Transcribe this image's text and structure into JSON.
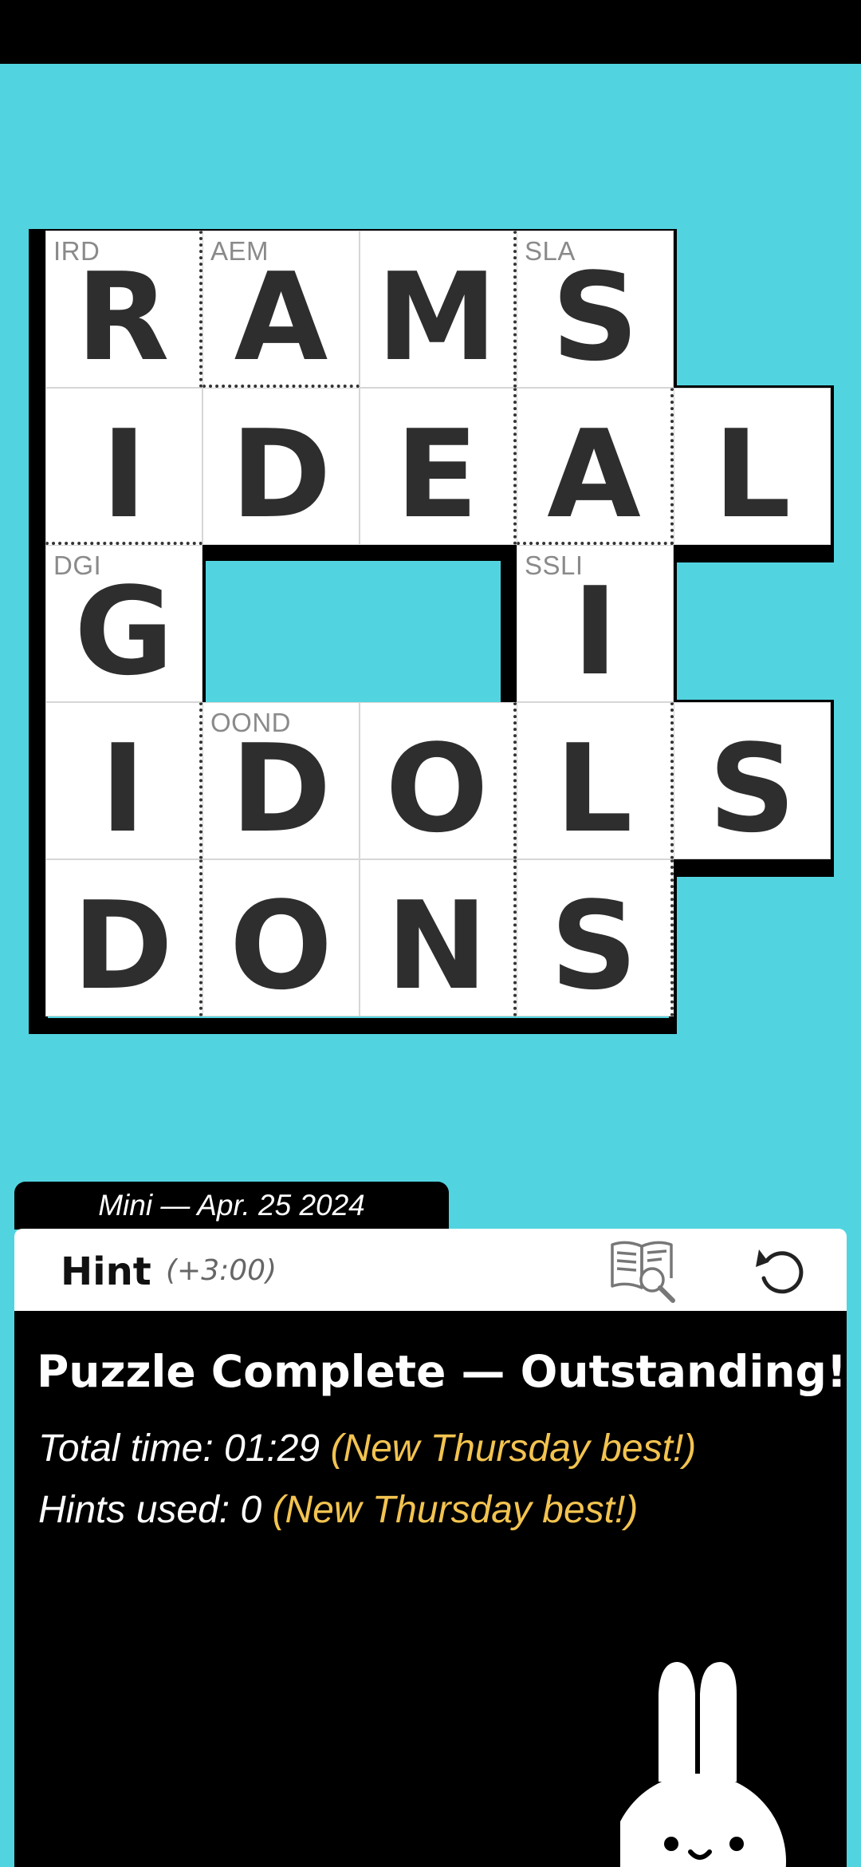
{
  "puzzle": {
    "rows": [
      [
        {
          "letter": "R",
          "clue": "IRD"
        },
        {
          "letter": "A",
          "clue": "AEM"
        },
        {
          "letter": "M",
          "clue": ""
        },
        {
          "letter": "S",
          "clue": "SLA"
        },
        null
      ],
      [
        {
          "letter": "I",
          "clue": ""
        },
        {
          "letter": "D",
          "clue": ""
        },
        {
          "letter": "E",
          "clue": ""
        },
        {
          "letter": "A",
          "clue": ""
        },
        {
          "letter": "L",
          "clue": ""
        }
      ],
      [
        {
          "letter": "G",
          "clue": "DGI"
        },
        null,
        null,
        {
          "letter": "I",
          "clue": "SSLI"
        },
        null
      ],
      [
        {
          "letter": "I",
          "clue": ""
        },
        {
          "letter": "D",
          "clue": "OOND"
        },
        {
          "letter": "O",
          "clue": ""
        },
        {
          "letter": "L",
          "clue": ""
        },
        {
          "letter": "S",
          "clue": ""
        }
      ],
      [
        {
          "letter": "D",
          "clue": ""
        },
        {
          "letter": "O",
          "clue": ""
        },
        {
          "letter": "N",
          "clue": ""
        },
        {
          "letter": "S",
          "clue": ""
        },
        null
      ]
    ]
  },
  "header": {
    "date_label": "Mini — Apr. 25 2024"
  },
  "toolbar": {
    "hint_label": "Hint",
    "hint_penalty": "(+3:00)",
    "hint_icon": "book-search-icon",
    "undo_icon": "undo-icon"
  },
  "result": {
    "title": "Puzzle Complete — Outstanding!",
    "time_text": "Total time: 01:29",
    "time_best": "(New Thursday best!)",
    "hints_text": "Hints used: 0",
    "hints_best": "(New Thursday best!)"
  },
  "colors": {
    "background": "#52d4e0",
    "highlight": "#f2c350"
  }
}
